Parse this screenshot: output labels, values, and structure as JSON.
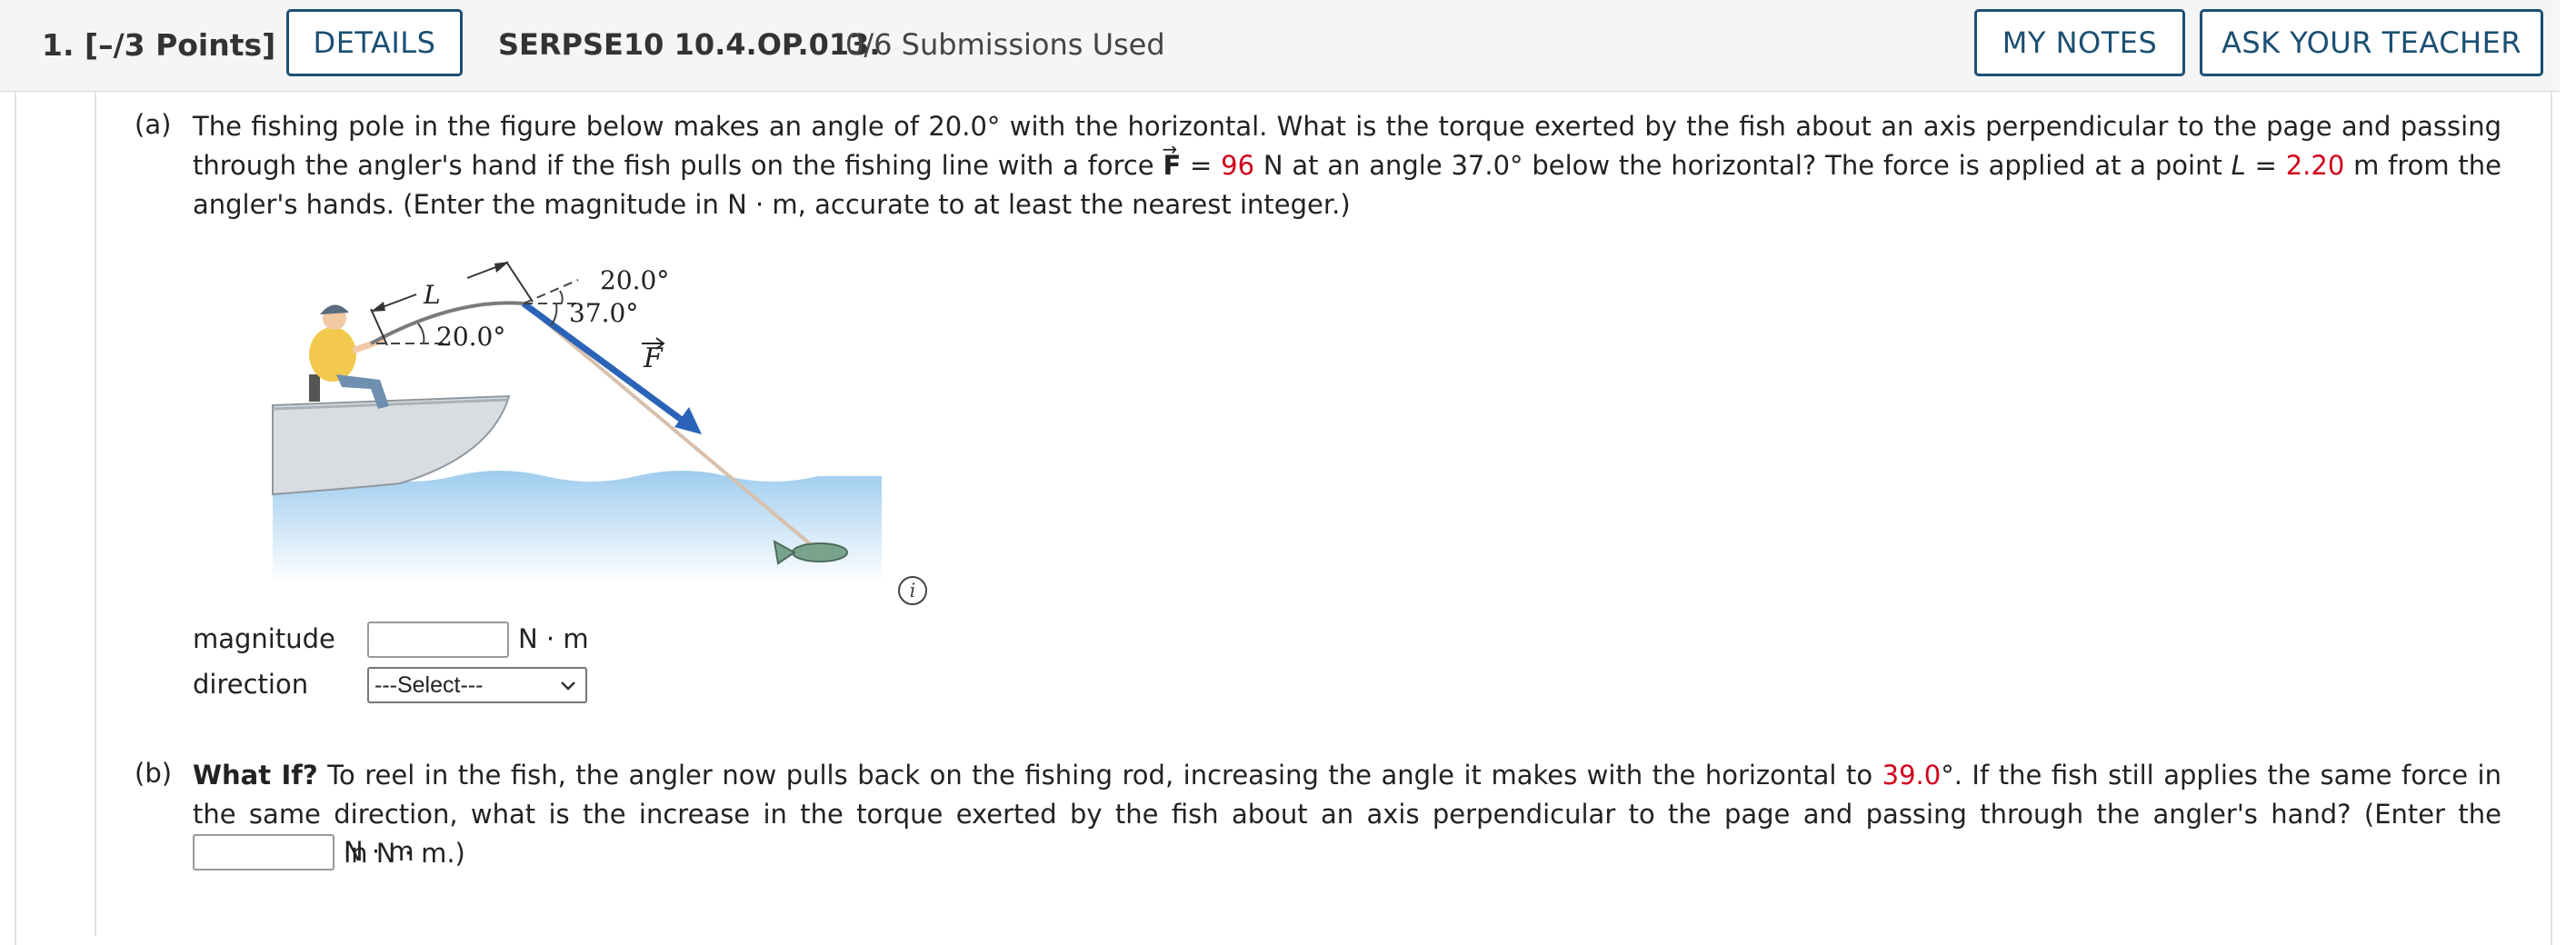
{
  "header": {
    "question_number": "1.  [–/3 Points]",
    "details_label": "DETAILS",
    "question_code": "SERPSE10 10.4.OP.013.",
    "submissions": "0/6 Submissions Used",
    "my_notes_label": "MY NOTES",
    "ask_teacher_label": "ASK YOUR TEACHER"
  },
  "part_a": {
    "label": "(a)",
    "text_1": "The fishing pole in the figure below makes an angle of 20.0° with the horizontal. What is the torque exerted by the fish about an axis perpendicular to the page and passing through the angler's hand if the fish pulls on the fishing line with a force ",
    "force_symbol": "F",
    "equals": " = ",
    "force_value": "96",
    "text_2": " N at an angle 37.0° below the horizontal? The force is applied at a point ",
    "length_symbol": "L",
    "length_value": "2.20",
    "text_3": " m from the angler's hands. (Enter the magnitude in N · m, accurate to at least the nearest integer.)",
    "magnitude_label": "magnitude",
    "magnitude_value": "",
    "magnitude_unit": "N · m",
    "direction_label": "direction",
    "direction_selected": "---Select---"
  },
  "figure": {
    "label_L": "L",
    "angle_pole_label": "20.0°",
    "angle_top_label": "20.0°",
    "angle_force_label": "37.0°",
    "force_label": "F",
    "info_icon_label": "i"
  },
  "part_b": {
    "label": "(b)",
    "what_if": "What If?",
    "text_1": " To reel in the fish, the angler now pulls back on the fishing rod, increasing the angle it makes with the horizontal to ",
    "angle_value": "39.0",
    "text_2": "°. If the fish still applies the same force in the same direction, what is the increase in the torque exerted by the fish about an axis perpendicular to the page and passing through the angler's hand? (Enter the magnitude in N · m.)",
    "answer_value": "",
    "unit": "N · m"
  },
  "colors": {
    "button_border": "#1b4f72",
    "red_value": "#d0021b",
    "force_arrow": "#2a63b8",
    "water": "#a9d2ee"
  }
}
